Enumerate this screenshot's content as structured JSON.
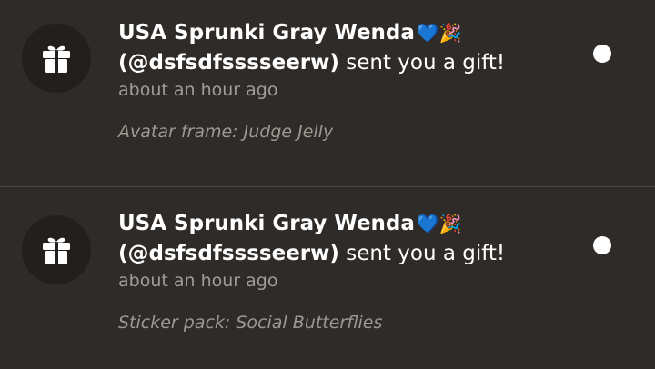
{
  "colors": {
    "background": "#2f2b28",
    "avatar_bg": "#221f1d",
    "muted_text": "#a29c96",
    "unread_dot": "#ffffff"
  },
  "notifications": [
    {
      "icon": "gift-icon",
      "sender_name": "USA Sprunki Gray Wenda",
      "sender_emoji": "💙🎉",
      "handle": "(@dsfsdfsssseerw)",
      "action": " sent you a gift!",
      "time": "about an hour ago",
      "detail": "Avatar frame: Judge Jelly",
      "unread": true
    },
    {
      "icon": "gift-icon",
      "sender_name": "USA Sprunki Gray Wenda",
      "sender_emoji": "💙🎉",
      "handle": "(@dsfsdfsssseerw)",
      "action": " sent you a gift!",
      "time": "about an hour ago",
      "detail": "Sticker pack: Social Butterflies",
      "unread": true
    }
  ]
}
